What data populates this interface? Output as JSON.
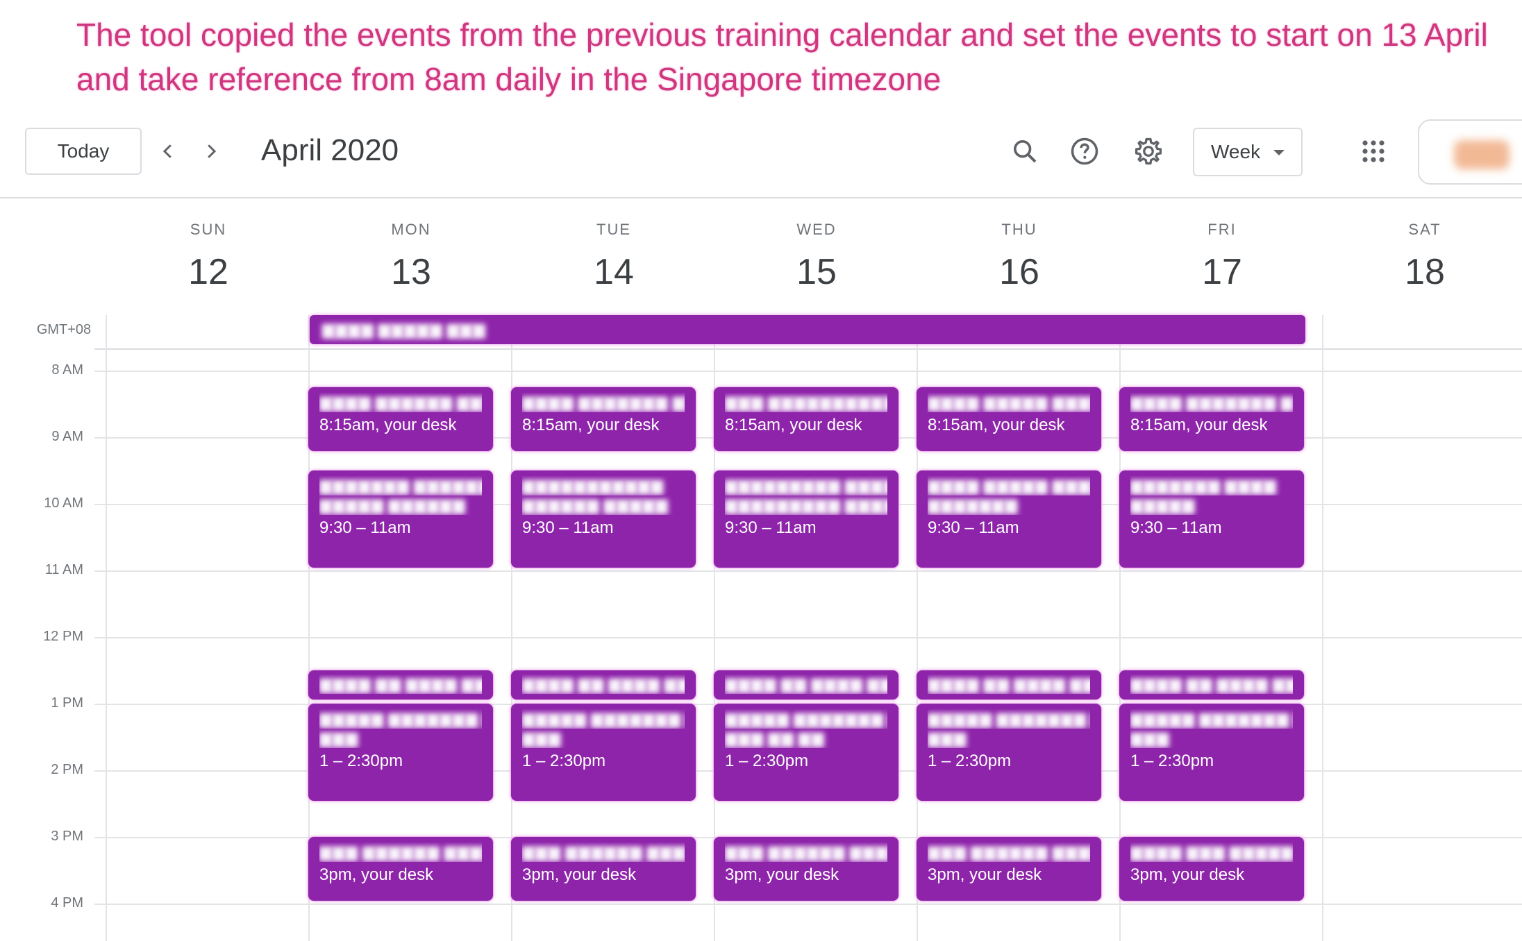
{
  "caption": "The tool copied the events from the previous training calendar and set the events to start on 13 April and take reference from 8am daily in the Singapore timezone",
  "toolbar": {
    "today_label": "Today",
    "month_title": "April 2020",
    "view_label": "Week",
    "icons": [
      "chevron-left-icon",
      "chevron-right-icon",
      "search-icon",
      "help-icon",
      "gear-icon",
      "chevron-down-icon",
      "apps-grid-icon"
    ]
  },
  "days": [
    {
      "name": "SUN",
      "num": "12"
    },
    {
      "name": "MON",
      "num": "13"
    },
    {
      "name": "TUE",
      "num": "14"
    },
    {
      "name": "WED",
      "num": "15"
    },
    {
      "name": "THU",
      "num": "16"
    },
    {
      "name": "FRI",
      "num": "17"
    },
    {
      "name": "SAT",
      "num": "18"
    }
  ],
  "timezone": "GMT+08",
  "hours": [
    "8 AM",
    "9 AM",
    "10 AM",
    "11 AM",
    "12 PM",
    "1 PM",
    "2 PM",
    "3 PM",
    "4 PM"
  ],
  "event_times": {
    "morning": "8:15am, your desk",
    "session_am": "9:30 – 11am",
    "session_pm": "1 – 2:30pm",
    "afternoon": "3pm, your desk"
  },
  "colors": {
    "event": "#8e24aa",
    "caption": "#d0367e"
  }
}
